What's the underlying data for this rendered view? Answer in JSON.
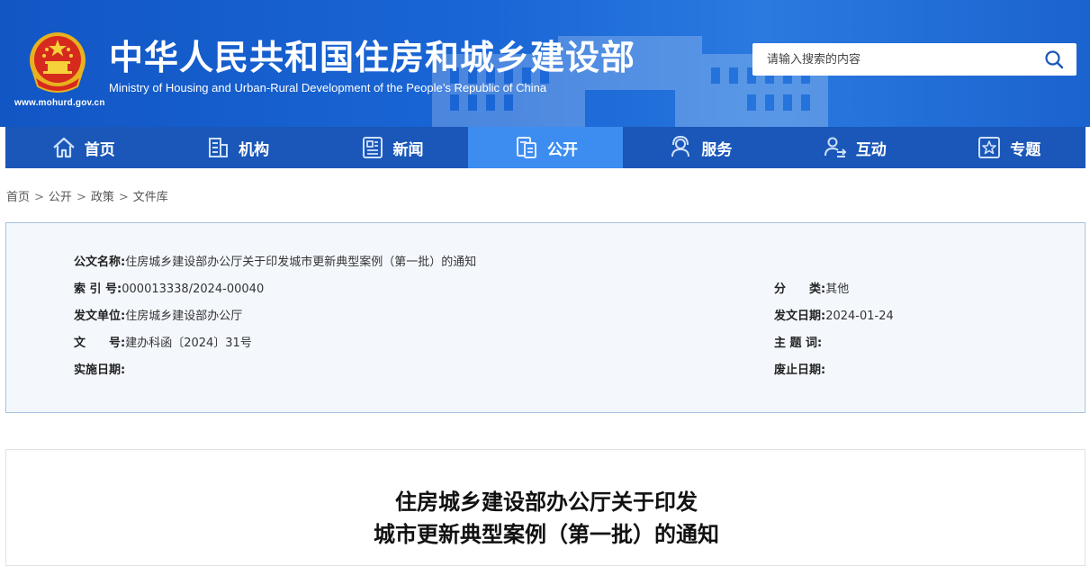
{
  "header": {
    "site_url": "www.mohurd.gov.cn",
    "title": "中华人民共和国住房和城乡建设部",
    "subtitle": "Ministry of Housing and Urban-Rural Development of the People’s Republic of China",
    "search_placeholder": "请输入搜索的内容",
    "brand_color": "#1a57b8",
    "active_color": "#3d8df0"
  },
  "nav": {
    "items": [
      {
        "label": "首页",
        "icon": "home-icon"
      },
      {
        "label": "机构",
        "icon": "building-icon"
      },
      {
        "label": "新闻",
        "icon": "news-icon"
      },
      {
        "label": "公开",
        "icon": "document-icon",
        "active": true
      },
      {
        "label": "服务",
        "icon": "service-icon"
      },
      {
        "label": "互动",
        "icon": "interact-icon"
      },
      {
        "label": "专题",
        "icon": "star-icon"
      }
    ]
  },
  "breadcrumb": [
    "首页",
    "公开",
    "政策",
    "文件库"
  ],
  "info": {
    "name_label": "公文名称:",
    "name_value": "住房城乡建设部办公厅关于印发城市更新典型案例（第一批）的通知",
    "index_label": "索 引 号:",
    "index_value": "000013338/2024-00040",
    "category_label": "分　　类:",
    "category_value": "其他",
    "issuer_label": "发文单位:",
    "issuer_value": "住房城乡建设部办公厅",
    "date_label": "发文日期:",
    "date_value": "2024-01-24",
    "docno_label": "文　　号:",
    "docno_value": "建办科函〔2024〕31号",
    "keyword_label": "主 题 词:",
    "keyword_value": "",
    "effective_label": "实施日期:",
    "effective_value": "",
    "expire_label": "废止日期:",
    "expire_value": ""
  },
  "article": {
    "title_line1": "住房城乡建设部办公厅关于印发",
    "title_line2": "城市更新典型案例（第一批）的通知"
  }
}
